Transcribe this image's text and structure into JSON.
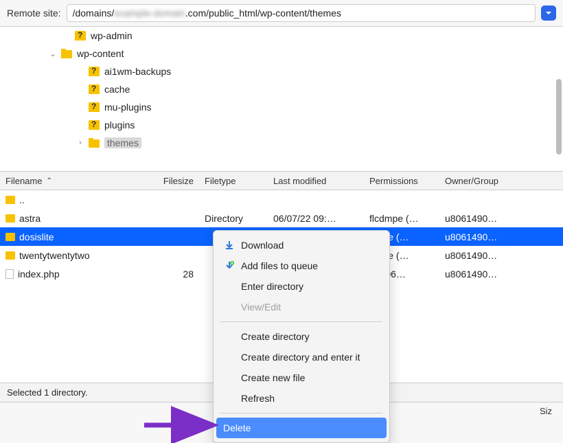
{
  "path_bar": {
    "label": "Remote site:",
    "path_prefix": "/domains/",
    "path_blur": "example-domain",
    "path_suffix": ".com/public_html/wp-content/themes"
  },
  "tree": {
    "items": [
      {
        "indent": 90,
        "icon": "q",
        "label": "wp-admin"
      },
      {
        "indent": 70,
        "icon": "f",
        "label": "wp-content",
        "expander": "⌄"
      },
      {
        "indent": 110,
        "icon": "q",
        "label": "ai1wm-backups"
      },
      {
        "indent": 110,
        "icon": "q",
        "label": "cache"
      },
      {
        "indent": 110,
        "icon": "q",
        "label": "mu-plugins"
      },
      {
        "indent": 110,
        "icon": "q",
        "label": "plugins"
      },
      {
        "indent": 110,
        "icon": "f",
        "label": "themes",
        "expander": "›",
        "selected": true
      }
    ]
  },
  "columns": {
    "name": "Filename",
    "size": "Filesize",
    "type": "Filetype",
    "mod": "Last modified",
    "perm": "Permissions",
    "own": "Owner/Group",
    "siz2": "Siz"
  },
  "rows": [
    {
      "icon": "folder",
      "name": "..",
      "size": "",
      "type": "",
      "mod": "",
      "perm": "",
      "own": ""
    },
    {
      "icon": "folder",
      "name": "astra",
      "size": "",
      "type": "Directory",
      "mod": "06/07/22 09:…",
      "perm": "flcdmpe (…",
      "own": "u8061490…"
    },
    {
      "icon": "folder",
      "name": "dosislite",
      "size": "",
      "type": "",
      "mod": "",
      "perm": "dmpe (…",
      "own": "u8061490…",
      "selected": true
    },
    {
      "icon": "folder",
      "name": "twentytwentytwo",
      "size": "",
      "type": "",
      "mod": "",
      "perm": "dmpe (…",
      "own": "u8061490…"
    },
    {
      "icon": "php",
      "name": "index.php",
      "size": "28",
      "type": "",
      "mod": "",
      "perm": "rw (06…",
      "own": "u8061490…"
    }
  ],
  "context_menu": {
    "items": [
      {
        "icon": "download",
        "label": "Download"
      },
      {
        "icon": "queue",
        "label": "Add files to queue"
      },
      {
        "label": "Enter directory"
      },
      {
        "label": "View/Edit",
        "disabled": true
      },
      {
        "sep": true
      },
      {
        "label": "Create directory"
      },
      {
        "label": "Create directory and enter it"
      },
      {
        "label": "Create new file"
      },
      {
        "label": "Refresh"
      },
      {
        "sep": true
      },
      {
        "label": "Delete",
        "highlight": true
      }
    ]
  },
  "status": "Selected 1 directory."
}
